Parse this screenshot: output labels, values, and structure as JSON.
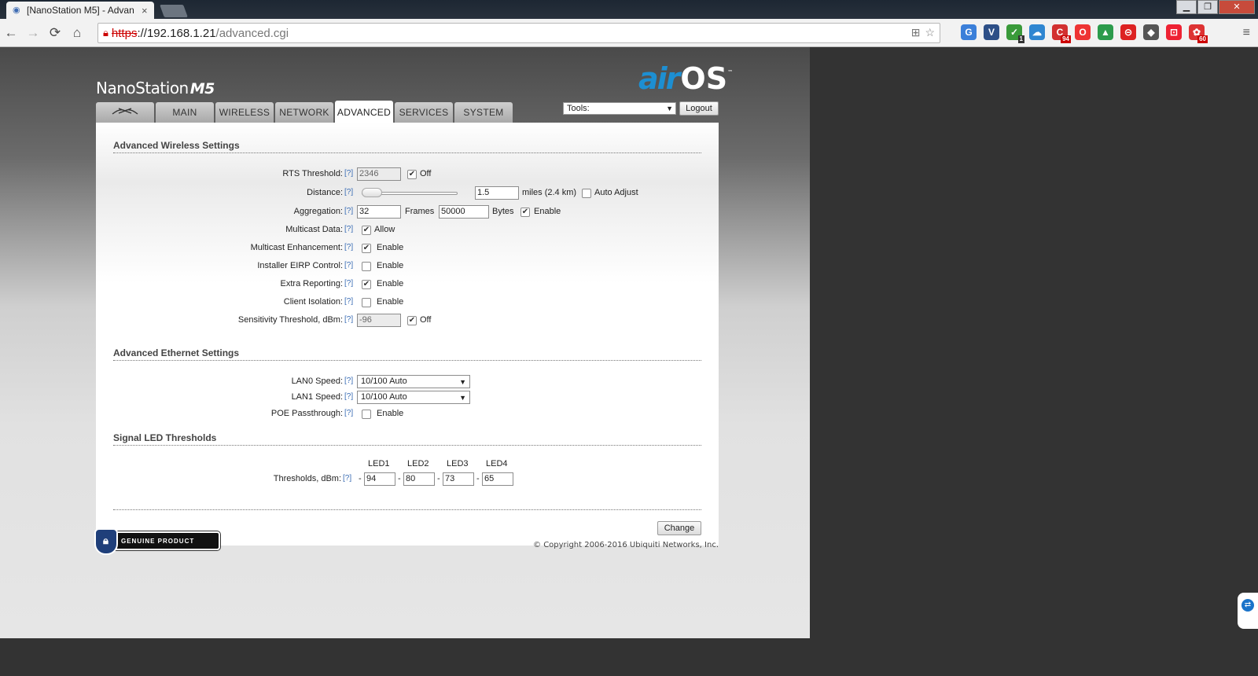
{
  "browser": {
    "tab_title": "[NanoStation M5] - Advan",
    "tab_close": "×",
    "url_scheme": "https",
    "url_host": "://192.168.1.21",
    "url_path": "/advanced.cgi",
    "ext_badges": [
      "1",
      "94",
      "60"
    ]
  },
  "header": {
    "brand_name": "NanoStation",
    "brand_model": "M5",
    "logo_air": "air",
    "logo_os": "OS",
    "logo_tm": "™",
    "tabs": [
      "MAIN",
      "WIRELESS",
      "NETWORK",
      "ADVANCED",
      "SERVICES",
      "SYSTEM"
    ],
    "active_tab": "ADVANCED",
    "tools_label": "Tools:",
    "logout_label": "Logout"
  },
  "wireless": {
    "title": "Advanced Wireless Settings",
    "help": "[?]",
    "rts": {
      "label": "RTS Threshold:",
      "value": "2346",
      "off_label": "Off",
      "off_checked": true
    },
    "distance": {
      "label": "Distance:",
      "value": "1.5",
      "unit": "miles (2.4 km)",
      "auto_label": "Auto Adjust",
      "auto_checked": false
    },
    "aggregation": {
      "label": "Aggregation:",
      "frames": "32",
      "frames_label": "Frames",
      "bytes": "50000",
      "bytes_label": "Bytes",
      "enable_label": "Enable",
      "enabled": true
    },
    "multicast_data": {
      "label": "Multicast Data:",
      "option": "Allow",
      "checked": true
    },
    "multicast_enh": {
      "label": "Multicast Enhancement:",
      "option": "Enable",
      "checked": true
    },
    "eirp": {
      "label": "Installer EIRP Control:",
      "option": "Enable",
      "checked": false
    },
    "extra_reporting": {
      "label": "Extra Reporting:",
      "option": "Enable",
      "checked": true
    },
    "client_isolation": {
      "label": "Client Isolation:",
      "option": "Enable",
      "checked": false
    },
    "sensitivity": {
      "label": "Sensitivity Threshold, dBm:",
      "value": "-96",
      "off_label": "Off",
      "off_checked": true
    }
  },
  "ethernet": {
    "title": "Advanced Ethernet Settings",
    "lan0": {
      "label": "LAN0 Speed:",
      "value": "10/100 Auto"
    },
    "lan1": {
      "label": "LAN1 Speed:",
      "value": "10/100 Auto"
    },
    "poe": {
      "label": "POE Passthrough:",
      "option": "Enable",
      "checked": false
    }
  },
  "led": {
    "title": "Signal LED Thresholds",
    "label": "Thresholds, dBm:",
    "dash": "-",
    "headers": [
      "LED1",
      "LED2",
      "LED3",
      "LED4"
    ],
    "values": [
      "94",
      "80",
      "73",
      "65"
    ]
  },
  "footer": {
    "change_label": "Change",
    "genuine_label": "GENUINE    PRODUCT",
    "copyright": "© Copyright 2006-2016 Ubiquiti Networks, Inc."
  }
}
